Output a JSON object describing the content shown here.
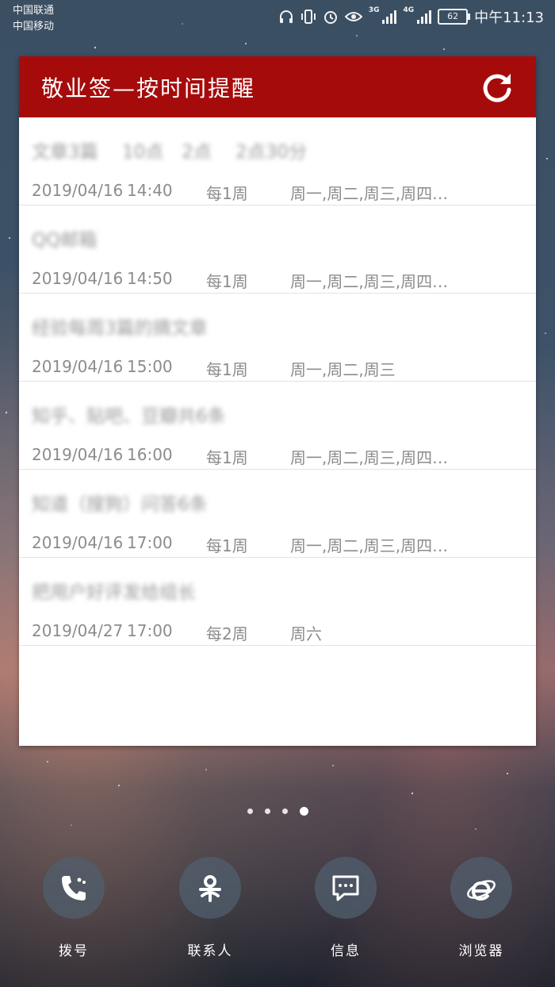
{
  "status_bar": {
    "carrier1": "中国联通",
    "carrier2": "中国移动",
    "net1": "3G",
    "net2": "4G",
    "battery": "62",
    "time": "中午11:13"
  },
  "widget": {
    "title": "敬业签—按时间提醒",
    "items": [
      {
        "title": "文章3篇　 10点　2点　 2点30分",
        "date": "2019/04/16",
        "time": "14:40",
        "repeat": "每1周",
        "days": "周一,周二,周三,周四…"
      },
      {
        "title": "QQ邮箱",
        "date": "2019/04/16",
        "time": "14:50",
        "repeat": "每1周",
        "days": "周一,周二,周三,周四…"
      },
      {
        "title": "经验每周3篇的摘文章",
        "date": "2019/04/16",
        "time": "15:00",
        "repeat": "每1周",
        "days": "周一,周二,周三"
      },
      {
        "title": "知乎、贴吧、豆瓣共6条",
        "date": "2019/04/16",
        "time": "16:00",
        "repeat": "每1周",
        "days": "周一,周二,周三,周四…"
      },
      {
        "title": "知道（搜狗）问答6条",
        "date": "2019/04/16",
        "time": "17:00",
        "repeat": "每1周",
        "days": "周一,周二,周三,周四…"
      },
      {
        "title": "把用户好评发给组长",
        "date": "2019/04/27",
        "time": "17:00",
        "repeat": "每2周",
        "days": "周六"
      }
    ]
  },
  "page_indicator": {
    "count": 4,
    "active": 4
  },
  "dock": [
    {
      "label": "拨号",
      "icon": "phone-icon"
    },
    {
      "label": "联系人",
      "icon": "contacts-icon"
    },
    {
      "label": "信息",
      "icon": "message-icon"
    },
    {
      "label": "浏览器",
      "icon": "browser-icon"
    }
  ]
}
